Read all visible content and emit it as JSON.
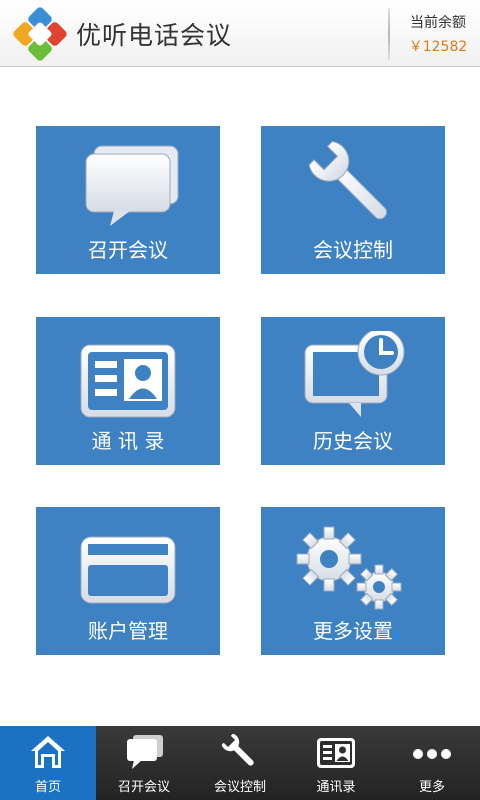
{
  "header": {
    "title": "优听电话会议",
    "balance_label": "当前余额",
    "balance_value": "￥12582",
    "balance_color": "#e07a14"
  },
  "tiles": [
    {
      "label": "召开会议",
      "icon": "chat-bubbles-icon"
    },
    {
      "label": "会议控制",
      "icon": "wrench-icon"
    },
    {
      "label": "通 讯 录",
      "icon": "contact-card-icon"
    },
    {
      "label": "历史会议",
      "icon": "clock-screen-icon"
    },
    {
      "label": "账户管理",
      "icon": "credit-card-icon"
    },
    {
      "label": "更多设置",
      "icon": "gears-icon"
    }
  ],
  "tabbar": {
    "items": [
      {
        "label": "首页",
        "icon": "home-icon",
        "active": true
      },
      {
        "label": "召开会议",
        "icon": "chat-icon",
        "active": false
      },
      {
        "label": "会议控制",
        "icon": "wrench-icon",
        "active": false
      },
      {
        "label": "通讯录",
        "icon": "contact-card-icon",
        "active": false
      },
      {
        "label": "更多",
        "icon": "more-dots-icon",
        "active": false
      }
    ]
  },
  "colors": {
    "tile": "#3f82c4",
    "tab_active": "#1a73c2",
    "tab_bar": "#2e2e2e"
  }
}
